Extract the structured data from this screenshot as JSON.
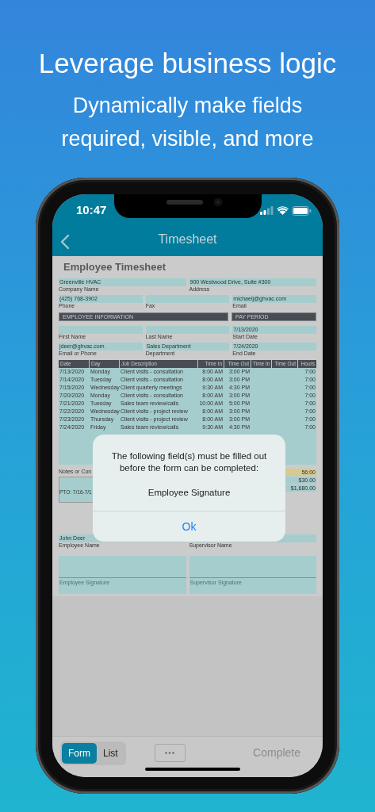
{
  "headline": "Leverage business logic",
  "subheadline": "Dynamically make fields required, visible, and more",
  "status_bar": {
    "time": "10:47"
  },
  "nav": {
    "title": "Timesheet"
  },
  "form": {
    "title": "Employee Timesheet",
    "rows": [
      {
        "kind": "fields",
        "items": [
          {
            "value": "Greenville HVAC",
            "label": "Company Name"
          },
          {
            "value": "900 Westwood Drive, Suite #300",
            "label": "Address"
          }
        ]
      },
      {
        "kind": "fields",
        "items": [
          {
            "value": "(425) 768-3902",
            "label": "Phone"
          },
          {
            "label": "Fax"
          },
          {
            "value": "michaelj@ghvac.com",
            "label": "Email"
          }
        ]
      },
      {
        "kind": "headers",
        "items": [
          {
            "label": "EMPLOYEE INFORMATION"
          },
          {
            "label": "PAY PERIOD"
          }
        ]
      },
      {
        "kind": "fields",
        "items": [
          {
            "label": "First Name"
          },
          {
            "label": "Last Name"
          },
          {
            "value": "7/13/2020",
            "label": "Start Date"
          }
        ]
      },
      {
        "kind": "fields",
        "items": [
          {
            "value": "jdeer@ghvac.com",
            "label": "Email or Phone"
          },
          {
            "value": "Sales Department",
            "label": "Department"
          },
          {
            "value": "7/24/2020",
            "label": "End Date"
          }
        ]
      }
    ],
    "table": {
      "columns": [
        "Date",
        "Day",
        "Job Description",
        "Time In",
        "Time Out",
        "Time In",
        "Time Out",
        "Hours"
      ],
      "rows": [
        [
          "7/13/2020",
          "Monday",
          "Client visits - consultation",
          "8:00 AM",
          "3:00 PM",
          "",
          "",
          "7:00"
        ],
        [
          "7/14/2020",
          "Tuesday",
          "Client visits - consultation",
          "8:00 AM",
          "3:00 PM",
          "",
          "",
          "7:00"
        ],
        [
          "7/15/2020",
          "Wednesday",
          "Client quarterly meetings",
          "9:30 AM",
          "4:30 PM",
          "",
          "",
          "7:00"
        ],
        [
          "7/20/2020",
          "Monday",
          "Client visits - consultation",
          "8:00 AM",
          "3:00 PM",
          "",
          "",
          "7:00"
        ],
        [
          "7/21/2020",
          "Tuesday",
          "Sales team review/calls",
          "10:00 AM",
          "5:00 PM",
          "",
          "",
          "7:00"
        ],
        [
          "7/22/2020",
          "Wednesday",
          "Client visits - project review",
          "8:00 AM",
          "3:00 PM",
          "",
          "",
          "7:00"
        ],
        [
          "7/23/2020",
          "Thursday",
          "Client visits - project review",
          "8:00 AM",
          "3:00 PM",
          "",
          "",
          "7:00"
        ],
        [
          "7/24/2020",
          "Friday",
          "Sales team review/calls",
          "9:30 AM",
          "4:30 PM",
          "",
          "",
          "7:00"
        ]
      ]
    },
    "notes": {
      "label": "Notes or Con",
      "value": "PTO: 7/16-7/1"
    },
    "totals": [
      {
        "value": "56:00",
        "highlighted": true
      },
      {
        "value": "$30.00",
        "highlighted": false
      },
      {
        "value": "$1,680.00",
        "highlighted": false
      }
    ],
    "signers": [
      {
        "name": "John Deer",
        "name_label": "Employee Name",
        "signature_placeholder": "Employee Signature"
      },
      {
        "name_label": "Supervisor Name",
        "signature_placeholder": "Supervisor Signature"
      }
    ]
  },
  "alert": {
    "message": "The following field(s) must be filled out before the form can be completed:",
    "field": "Employee Signature",
    "button": "Ok"
  },
  "toolbar": {
    "views": [
      {
        "label": "Form",
        "selected": true
      },
      {
        "label": "List",
        "selected": false
      }
    ],
    "more": "•••",
    "action": {
      "label": "Complete",
      "disabled": true
    }
  }
}
